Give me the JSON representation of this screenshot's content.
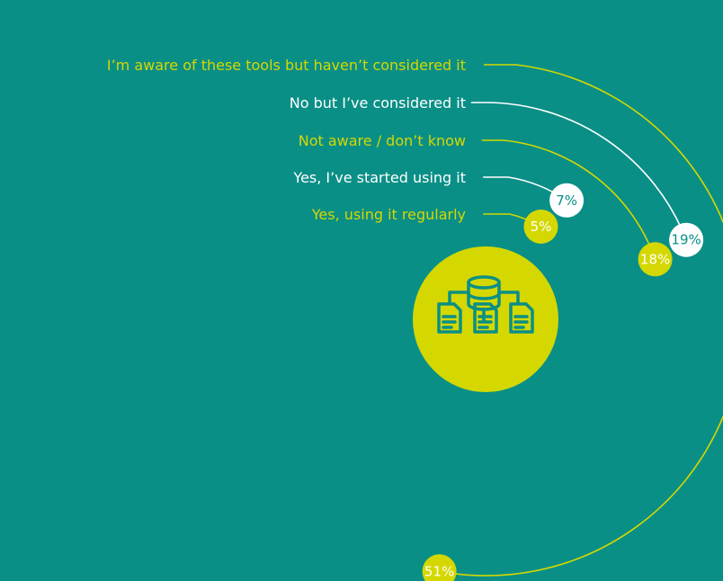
{
  "chart_data": {
    "type": "radial-arc",
    "title": "",
    "series": [
      {
        "label": "I’m aware of these tools but haven’t considered it",
        "value": 51,
        "value_label": "51%",
        "color": "#d4d800"
      },
      {
        "label": "No but I’ve considered it",
        "value": 19,
        "value_label": "19%",
        "color": "#ffffff"
      },
      {
        "label": "Not aware / don’t know",
        "value": 18,
        "value_label": "18%",
        "color": "#d4d800"
      },
      {
        "label": "Yes, I’ve started using it",
        "value": 7,
        "value_label": "7%",
        "color": "#ffffff"
      },
      {
        "label": "Yes, using it regularly",
        "value": 5,
        "value_label": "5%",
        "color": "#d4d800"
      }
    ]
  },
  "colors": {
    "background": "#0a8f86",
    "accent": "#d4d800",
    "light": "#ffffff"
  },
  "icon": {
    "name": "database-documents-icon"
  }
}
